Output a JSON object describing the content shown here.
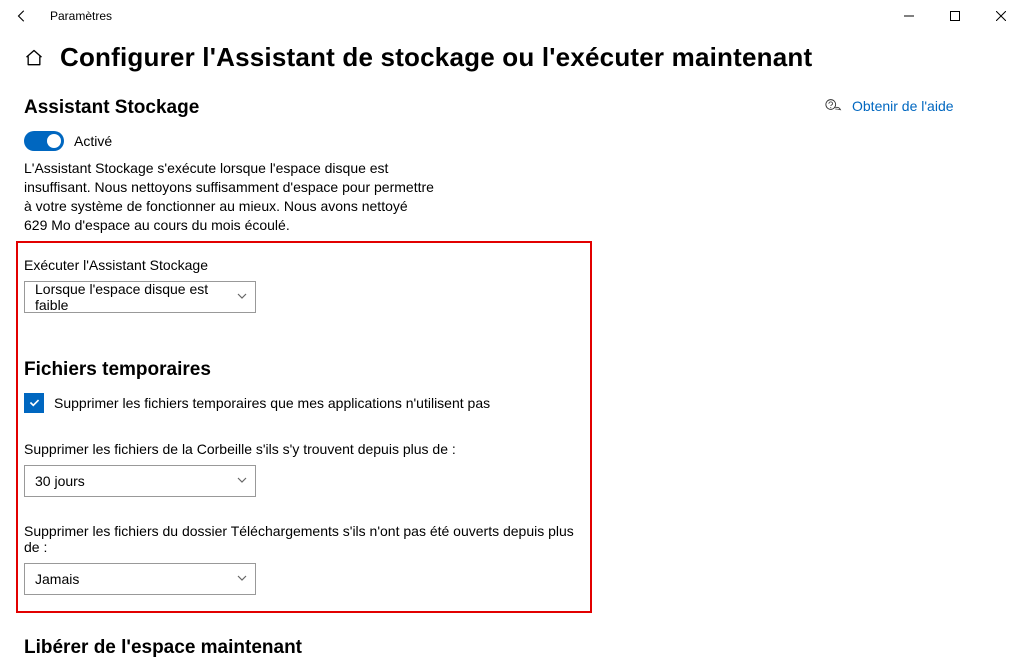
{
  "window": {
    "title": "Paramètres"
  },
  "page": {
    "title": "Configurer l'Assistant de stockage ou l'exécuter maintenant"
  },
  "storageSense": {
    "sectionTitle": "Assistant Stockage",
    "toggleState": "Activé",
    "description": "L'Assistant Stockage s'exécute lorsque l'espace disque est insuffisant. Nous nettoyons suffisamment d'espace pour permettre à votre système de fonctionner au mieux. Nous avons nettoyé 629 Mo d'espace au cours du mois écoulé.",
    "runLabel": "Exécuter l'Assistant Stockage",
    "runSelected": "Lorsque l'espace disque est faible"
  },
  "tempFiles": {
    "sectionTitle": "Fichiers temporaires",
    "checkboxLabel": "Supprimer les fichiers temporaires que mes applications n'utilisent pas",
    "recycleLabel": "Supprimer les fichiers de la Corbeille s'ils s'y trouvent depuis plus de :",
    "recycleSelected": "30 jours",
    "downloadsLabel": "Supprimer les fichiers du dossier Téléchargements s'ils n'ont pas été ouverts depuis plus de :",
    "downloadsSelected": "Jamais"
  },
  "freeNow": {
    "sectionTitle": "Libérer de l'espace maintenant"
  },
  "help": {
    "linkText": "Obtenir de l'aide"
  }
}
